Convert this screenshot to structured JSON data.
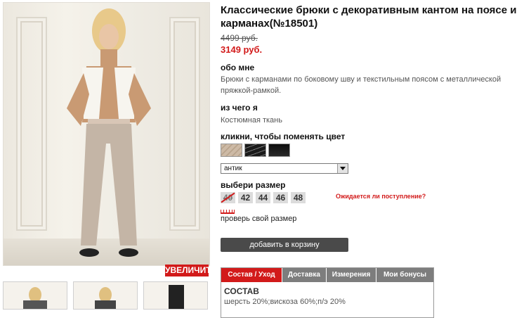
{
  "product": {
    "title": "Классические брюки с декоративным кантом на поясе и карманах(№18501)",
    "old_price": "4499 руб.",
    "new_price": "3149 руб."
  },
  "gallery": {
    "zoom_label": "УВЕЛИЧИТЬ"
  },
  "about": {
    "heading": "обо мне",
    "text": "Брюки с карманами по боковому шву и текстильным поясом с металлической пряжкой-рамкой."
  },
  "material": {
    "heading": "из чего я",
    "text": "Костюмная ткань"
  },
  "color": {
    "heading": "кликни, чтобы поменять цвет",
    "selected": "антик",
    "swatches": [
      {
        "name": "antique",
        "color": "#c9b7a3"
      },
      {
        "name": "black-striped",
        "color": "#1a1a1a"
      },
      {
        "name": "black",
        "color": "#0e0e0e"
      }
    ]
  },
  "size": {
    "heading": "выбери размер",
    "options": [
      "40",
      "42",
      "44",
      "46",
      "48"
    ],
    "waiting_link": "Ожидается ли поступление?",
    "check_link": "проверь свой размер"
  },
  "cart": {
    "button_label": "добавить в корзину"
  },
  "tabs": {
    "items": [
      "Состав / Уход",
      "Доставка",
      "Измерения",
      "Мои бонусы"
    ],
    "active_heading": "СОСТАВ",
    "active_text": "шерсть 20%;вискоза 60%;п/э 20%"
  }
}
